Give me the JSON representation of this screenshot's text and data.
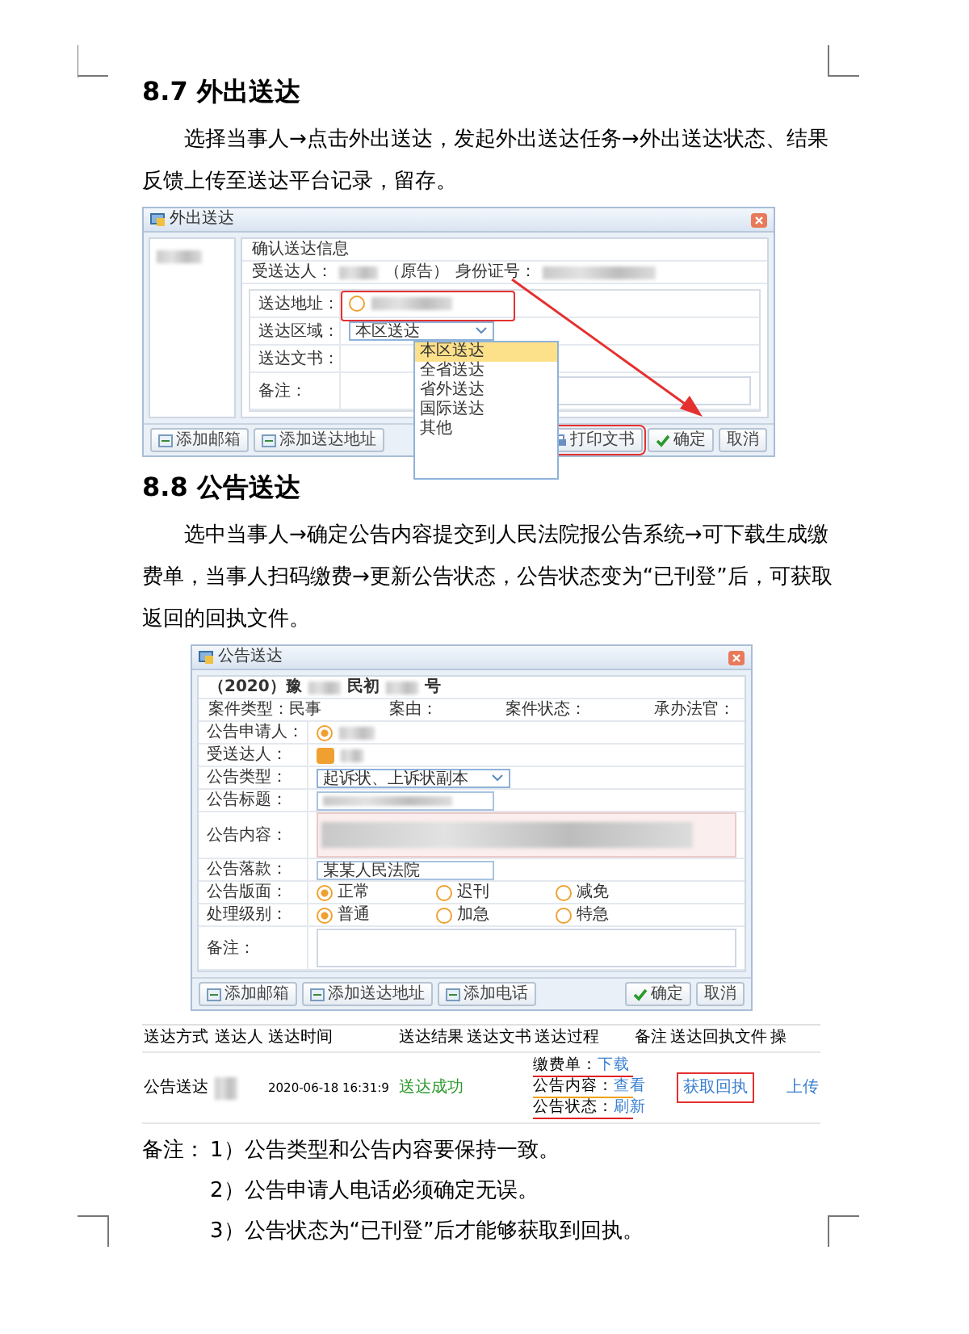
{
  "sections": [
    {
      "heading": "8.7  外出送达",
      "paragraph": "选择当事人→点击外出送达，发起外出送达任务→外出送达状态、结果反馈上传至送达平台记录，留存。"
    },
    {
      "heading": "8.8  公告送达",
      "paragraph": "选中当事人→确定公告内容提交到人民法院报公告系统→可下载生成缴费单，当事人扫码缴费→更新公告状态，公告状态变为“已刊登”后，可获取返回的回执文件。"
    }
  ],
  "dialog_outgoing": {
    "title": "外出送达",
    "info_title": "确认送达信息",
    "recipient_label": "受送达人：",
    "recipient_role": "（原告）",
    "id_label": "身份证号：",
    "rows": [
      {
        "kind": "address",
        "label": "送达地址：",
        "selected": false
      },
      {
        "kind": "select",
        "label": "送达区域：",
        "value": "本区送达"
      },
      {
        "kind": "text",
        "label": "送达文书："
      },
      {
        "kind": "textarea",
        "label": "备注："
      }
    ],
    "options": [
      {
        "label": "本区送达",
        "selected": true
      },
      {
        "label": "全省送达",
        "selected": false
      },
      {
        "label": "省外送达",
        "selected": false
      },
      {
        "label": "国际送达",
        "selected": false
      },
      {
        "label": "其他",
        "selected": false
      }
    ],
    "left_buttons": [
      "添加邮箱",
      "添加送达地址"
    ],
    "right_buttons": [
      {
        "kind": "print",
        "label": "打印文书"
      },
      {
        "kind": "ok",
        "label": "确定"
      },
      {
        "kind": "plain",
        "label": "取消"
      }
    ]
  },
  "dialog_notice": {
    "title": "公告送达",
    "case_prefix": "（2020）豫",
    "case_mid": "民初",
    "case_suffix": "号",
    "meta": [
      "案件类型：民事",
      "案由：",
      "案件状态：",
      "承办法官："
    ],
    "rows": [
      {
        "kind": "radio_person",
        "label": "公告申请人：",
        "selected": true
      },
      {
        "kind": "check_person",
        "label": "受送达人：",
        "checked": true
      },
      {
        "kind": "select",
        "label": "公告类型：",
        "value": "起诉状、上诉状副本"
      },
      {
        "kind": "blur_input",
        "label": "公告标题："
      },
      {
        "kind": "content",
        "label": "公告内容："
      },
      {
        "kind": "input",
        "label": "公告落款：",
        "value": "某某人民法院"
      },
      {
        "kind": "radios",
        "label": "公告版面：",
        "options": [
          {
            "label": "正常",
            "selected": true
          },
          {
            "label": "迟刊",
            "selected": false
          },
          {
            "label": "减免",
            "selected": false
          }
        ]
      },
      {
        "kind": "radios",
        "label": "处理级别：",
        "options": [
          {
            "label": "普通",
            "selected": true
          },
          {
            "label": "加急",
            "selected": false
          },
          {
            "label": "特急",
            "selected": false
          }
        ]
      },
      {
        "kind": "textarea",
        "label": "备注："
      }
    ],
    "left_buttons": [
      "添加邮箱",
      "添加送达地址",
      "添加电话"
    ],
    "right_buttons": [
      {
        "kind": "ok",
        "label": "确定"
      },
      {
        "kind": "plain",
        "label": "取消"
      }
    ]
  },
  "record_table": {
    "columns": [
      "送达方式",
      "送达人",
      "送达时间",
      "送达结果",
      "送达文书",
      "送达过程",
      "备注",
      "送达回执文件",
      "操"
    ],
    "row": {
      "method": "公告送达",
      "time": "2020-06-18 16:31:9",
      "result": "送达成功",
      "process": [
        {
          "label": "缴费单：",
          "link": "下载",
          "color": "#e02020"
        },
        {
          "label": "公告内容：",
          "link": "查看",
          "color": "#f0a000"
        },
        {
          "label": "公告状态：",
          "link": "刷新",
          "color": "#e02020"
        }
      ],
      "receipt": "获取回执",
      "action": "上传"
    }
  },
  "notes": {
    "label": "备注：",
    "items": [
      "1）公告类型和公告内容要保持一致。",
      "2）公告申请人电话必须确定无误。",
      "3）公告状态为“已刊登”后才能够获取到回执。"
    ]
  }
}
